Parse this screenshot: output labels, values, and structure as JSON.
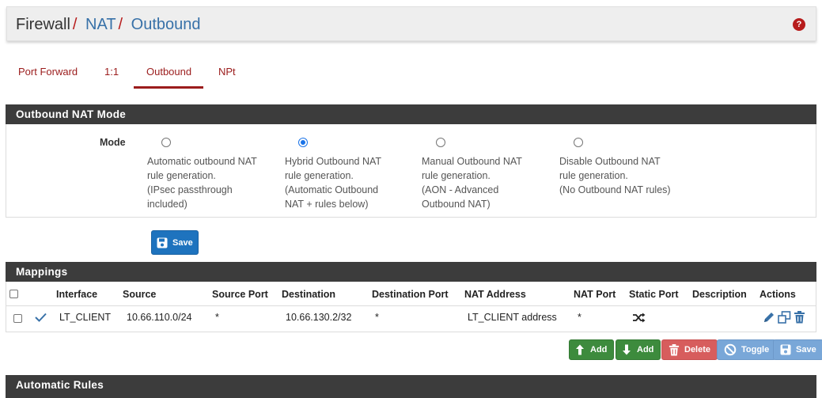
{
  "breadcrumb": {
    "items": [
      "Firewall",
      "NAT",
      "Outbound"
    ],
    "separator": "/",
    "help_glyph": "?"
  },
  "tabs": [
    {
      "label": "Port Forward",
      "active": false
    },
    {
      "label": "1:1",
      "active": false
    },
    {
      "label": "Outbound",
      "active": true
    },
    {
      "label": "NPt",
      "active": false
    }
  ],
  "outbound_mode": {
    "heading": "Outbound NAT Mode",
    "label": "Mode",
    "options": [
      {
        "lines": [
          "Automatic outbound NAT",
          "rule generation.",
          "(IPsec passthrough",
          "included)"
        ],
        "selected": false
      },
      {
        "lines": [
          "Hybrid Outbound NAT",
          "rule generation.",
          "(Automatic Outbound",
          "NAT + rules below)"
        ],
        "selected": true
      },
      {
        "lines": [
          "Manual Outbound NAT",
          "rule generation.",
          "(AON - Advanced",
          "Outbound NAT)"
        ],
        "selected": false
      },
      {
        "lines": [
          "Disable Outbound NAT",
          "rule generation.",
          "(No Outbound NAT rules)"
        ],
        "selected": false
      }
    ],
    "save_label": "Save"
  },
  "mappings": {
    "heading": "Mappings",
    "columns": [
      "Interface",
      "Source",
      "Source Port",
      "Destination",
      "Destination Port",
      "NAT Address",
      "NAT Port",
      "Static Port",
      "Description",
      "Actions"
    ],
    "rows": [
      {
        "enabled": true,
        "interface": "LT_CLIENT",
        "source": "10.66.110.0/24",
        "source_port": "*",
        "destination": "10.66.130.2/32",
        "destination_port": "*",
        "nat_address": "LT_CLIENT address",
        "nat_port": "*",
        "static_port_icon": "shuffle-icon",
        "description": ""
      }
    ],
    "buttons": {
      "add_top": "Add",
      "add_bottom": "Add",
      "delete": "Delete",
      "toggle": "Toggle",
      "save": "Save"
    }
  },
  "automatic_rules": {
    "heading": "Automatic Rules"
  },
  "colors": {
    "accent_red": "#9b1c1c",
    "link_blue": "#3871a8",
    "panel_dark": "#3c3c3c",
    "primary": "#1e73be",
    "success": "#3d8b3d",
    "danger": "#d75d5d",
    "info": "#79a7d8"
  }
}
